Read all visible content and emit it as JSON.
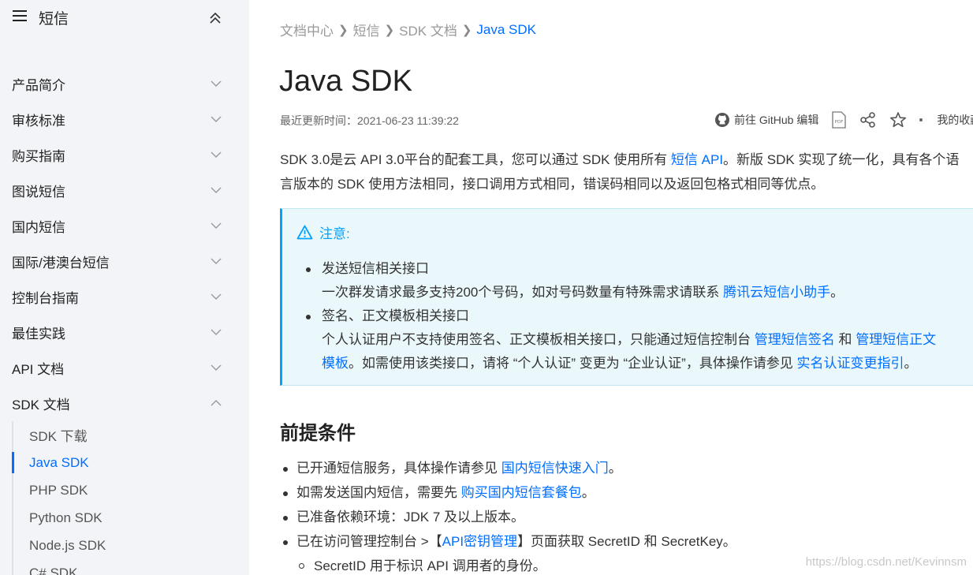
{
  "sidebar": {
    "title": "短信",
    "items": [
      {
        "label": "产品简介"
      },
      {
        "label": "审核标准"
      },
      {
        "label": "购买指南"
      },
      {
        "label": "图说短信"
      },
      {
        "label": "国内短信"
      },
      {
        "label": "国际/港澳台短信"
      },
      {
        "label": "控制台指南"
      },
      {
        "label": "最佳实践"
      },
      {
        "label": "API 文档"
      },
      {
        "label": "SDK 文档"
      }
    ],
    "sub_items": [
      {
        "label": "SDK 下载"
      },
      {
        "label": "Java SDK"
      },
      {
        "label": "PHP SDK"
      },
      {
        "label": "Python SDK"
      },
      {
        "label": "Node.js SDK"
      },
      {
        "label": "C# SDK"
      }
    ],
    "active_sub_index": 1
  },
  "breadcrumb": [
    "文档中心",
    "短信",
    "SDK 文档",
    "Java SDK"
  ],
  "page": {
    "title": "Java SDK",
    "updated": "最近更新时间：2021-06-23 11:39:22"
  },
  "toolbar": {
    "github_label": "前往 GitHub 编辑",
    "pdf_icon": "pdf-icon",
    "share_icon": "share-icon",
    "star_icon": "star-icon",
    "favorites_label": "我的收藏"
  },
  "intro": {
    "line1_before": "SDK 3.0是云 API 3.0平台的配套工具，您可以通过 SDK 使用所有 ",
    "line1_link": "短信 API",
    "line1_after": "。新版 SDK 实现了统一化，具有各个语",
    "line2": "言版本的 SDK 使用方法相同，接口调用方式相同，错误码相同以及返回包格式相同等优点。"
  },
  "notice": {
    "title": "注意:",
    "item1_title": "发送短信相关接口",
    "item1_text": "一次群发请求最多支持200个号码，如对号码数量有特殊需求请联系 ",
    "item1_link": "腾讯云短信小助手",
    "item1_end": "。",
    "item2_title": "签名、正文模板相关接口",
    "item2_text": "个人认证用户不支持使用签名、正文模板相关接口，只能通过短信控制台 ",
    "item2_link1": "管理短信签名",
    "item2_mid": " 和 ",
    "item2_link2a": "管理短信正文",
    "item2_link2b": "模板",
    "item2_text2": "。如需使用该类接口，请将 “个人认证” 变更为 “企业认证”，具体操作请参见 ",
    "item2_link3": "实名认证变更指引",
    "item2_end": "。"
  },
  "prereq": {
    "heading": "前提条件",
    "item1_text": "已开通短信服务，具体操作请参见 ",
    "item1_link": "国内短信快速入门",
    "item1_end": "。",
    "item2_text": "如需发送国内短信，需要先 ",
    "item2_link": "购买国内短信套餐包",
    "item2_end": "。",
    "item3_text": "已准备依赖环境：JDK 7 及以上版本。",
    "item4_text": "已在访问管理控制台 >【",
    "item4_link": "API密钥管理",
    "item4_end": "】页面获取 SecretID 和 SecretKey。",
    "sub1_text": "SecretID 用于标识 API 调用者的身份。"
  },
  "watermark": "https://blog.csdn.net/Kevinnsm",
  "colors": {
    "accent": "#006eff",
    "notice_accent": "#00a4ff",
    "sidebar_bg": "#f3f4f7"
  }
}
